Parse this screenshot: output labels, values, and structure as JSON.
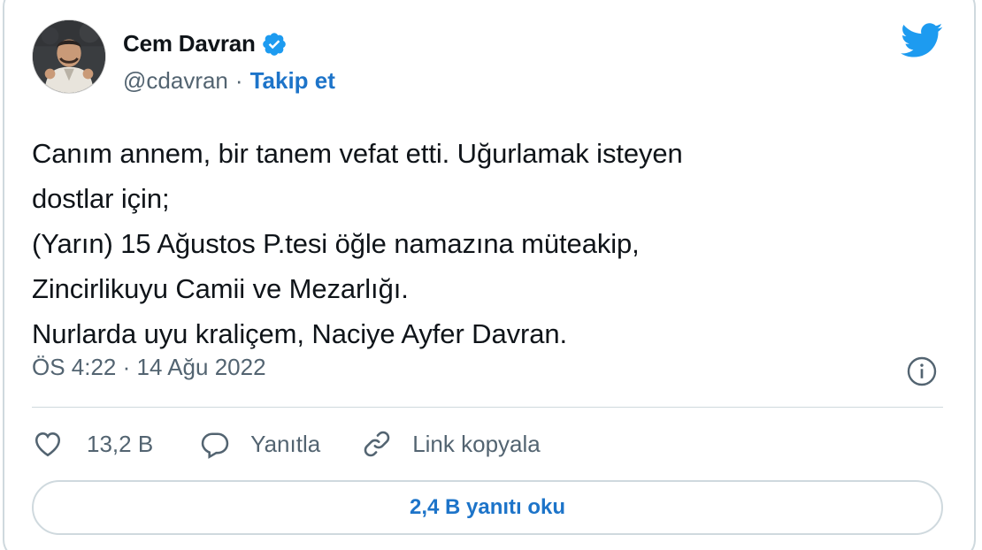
{
  "author": {
    "name": "Cem Davran",
    "handle": "@cdavran",
    "separator": "·",
    "follow_label": "Takip et",
    "verified": true,
    "avatar_icon": "profile-photo"
  },
  "brand": {
    "icon": "twitter-bird-icon",
    "color": "#1d9bf0"
  },
  "tweet": {
    "lines": [
      "Canım annem, bir tanem vefat etti. Uğurlamak isteyen",
      "dostlar için;",
      "(Yarın) 15 Ağustos P.tesi öğle namazına müteakip,",
      "Zincirlikuyu Camii ve Mezarlığı.",
      "Nurlarda uyu kraliçem, Naciye Ayfer Davran."
    ],
    "timestamp": "ÖS 4:22 · 14 Ağu 2022"
  },
  "actions": {
    "like_count": "13,2 B",
    "reply_label": "Yanıtla",
    "copy_link_label": "Link kopyala"
  },
  "read_replies_label": "2,4 B yanıtı oku",
  "colors": {
    "link": "#1d74c9",
    "secondary_text": "#536471",
    "border": "#cfd9de",
    "verified_badge": "#1d9bf0"
  }
}
